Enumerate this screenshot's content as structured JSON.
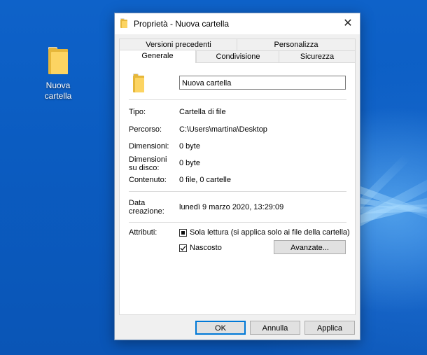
{
  "desktop": {
    "icon_label_line1": "Nuova",
    "icon_label_line2": "cartella"
  },
  "window": {
    "title": "Proprietà - Nuova cartella",
    "close_label": "✕",
    "tabs": {
      "versioni": "Versioni precedenti",
      "personalizza": "Personalizza",
      "generale": "Generale",
      "condivisione": "Condivisione",
      "sicurezza": "Sicurezza"
    },
    "name_value": "Nuova cartella",
    "info": {
      "tipo_label": "Tipo:",
      "tipo_value": "Cartella di file",
      "percorso_label": "Percorso:",
      "percorso_value": "C:\\Users\\martina\\Desktop",
      "dimensioni_label": "Dimensioni:",
      "dimensioni_value": "0 byte",
      "dimdisco_label_1": "Dimensioni",
      "dimdisco_label_2": "su disco:",
      "dimdisco_value": "0 byte",
      "contenuto_label": "Contenuto:",
      "contenuto_value": "0 file, 0 cartelle",
      "data_label_1": "Data",
      "data_label_2": "creazione:",
      "data_value": "lunedì 9 marzo 2020, 13:29:09"
    },
    "attributes": {
      "label": "Attributi:",
      "readonly_label": "Sola lettura (si applica solo ai file della cartella)",
      "hidden_label": "Nascosto",
      "hidden_checked": true,
      "advanced_label": "Avanzate..."
    },
    "buttons": {
      "ok": "OK",
      "cancel": "Annulla",
      "apply": "Applica"
    }
  }
}
